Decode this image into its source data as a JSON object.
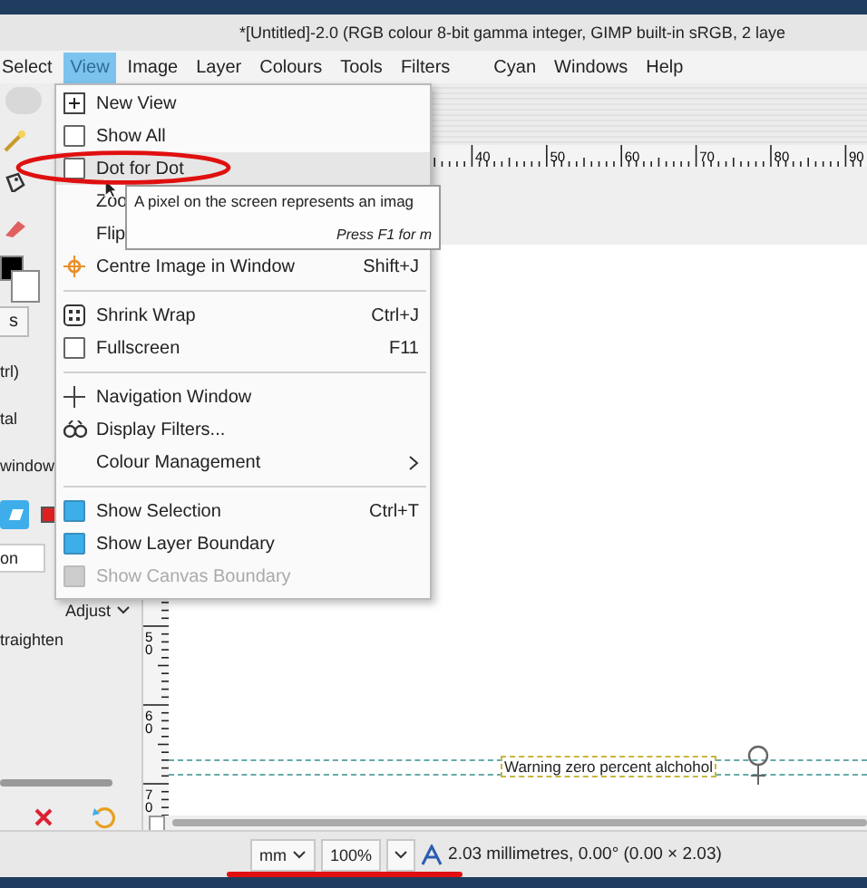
{
  "title_bar": {
    "title": "*[Untitled]-2.0 (RGB colour 8-bit gamma integer, GIMP built-in sRGB, 2 laye"
  },
  "menubar": [
    {
      "label": "Select",
      "selected": false
    },
    {
      "label": "View",
      "selected": true
    },
    {
      "label": "Image",
      "selected": false
    },
    {
      "label": "Layer",
      "selected": false
    },
    {
      "label": "Colours",
      "selected": false
    },
    {
      "label": "Tools",
      "selected": false
    },
    {
      "label": "Filters",
      "selected": false
    },
    {
      "label": "Cyan",
      "selected": false
    },
    {
      "label": "Windows",
      "selected": false
    },
    {
      "label": "Help",
      "selected": false
    }
  ],
  "toolbox": {
    "tab": "s",
    "options": [
      "trl)",
      "tal",
      "window"
    ],
    "field_label": "on",
    "dropdown": "Adjust",
    "list_item": "traighten"
  },
  "view_menu": {
    "items": [
      {
        "kind": "command",
        "label": "New View",
        "selected": false
      },
      {
        "kind": "check",
        "label": "Show All",
        "checked": false,
        "disabled": false,
        "selected": false
      },
      {
        "kind": "check",
        "label": "Dot for Dot",
        "checked": false,
        "disabled": false,
        "selected": true
      },
      {
        "kind": "command",
        "label": "Zoo",
        "selected": false
      },
      {
        "kind": "command",
        "label": "Flip",
        "selected": false
      },
      {
        "kind": "command",
        "label": "Centre Image in Window",
        "shortcut": "Shift+J",
        "selected": false
      },
      {
        "kind": "separator"
      },
      {
        "kind": "command",
        "label": "Shrink Wrap",
        "shortcut": "Ctrl+J",
        "selected": false
      },
      {
        "kind": "check",
        "label": "Fullscreen",
        "shortcut": "F11",
        "checked": false,
        "disabled": false,
        "selected": false
      },
      {
        "kind": "separator"
      },
      {
        "kind": "command",
        "label": "Navigation Window",
        "selected": false
      },
      {
        "kind": "command",
        "label": "Display Filters...",
        "selected": false
      },
      {
        "kind": "submenu",
        "label": "Colour Management",
        "selected": false
      },
      {
        "kind": "separator"
      },
      {
        "kind": "check",
        "label": "Show Selection",
        "shortcut": "Ctrl+T",
        "checked": true,
        "disabled": false,
        "selected": false
      },
      {
        "kind": "check",
        "label": "Show Layer Boundary",
        "checked": true,
        "disabled": false,
        "selected": false
      },
      {
        "kind": "check",
        "label": "Show Canvas Boundary",
        "checked": true,
        "disabled": true,
        "selected": false
      }
    ]
  },
  "tooltip": {
    "text": "A pixel on the screen represents an imag",
    "hint": "Press F1 for m"
  },
  "top_ruler": {
    "labels": [
      "40",
      "50",
      "60",
      "70",
      "80",
      "90"
    ]
  },
  "left_ruler": {
    "labels": [
      "50",
      "60",
      "70"
    ]
  },
  "canvas": {
    "text_layer": "Warning zero percent alchohol"
  },
  "status_bar": {
    "unit": "mm",
    "zoom": "100%",
    "pointer": "2.03 millimetres, 0.00° (0.00 × 2.03)"
  }
}
